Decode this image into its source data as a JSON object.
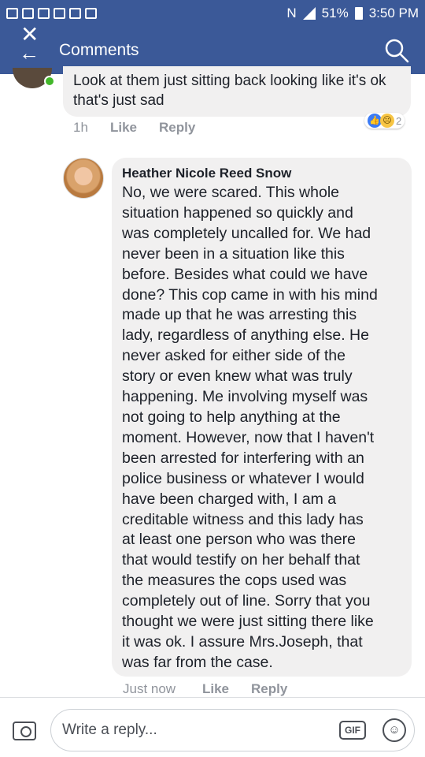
{
  "status_bar": {
    "battery": "51%",
    "time": "3:50 PM"
  },
  "header": {
    "title": "Comments"
  },
  "comments": [
    {
      "text": "Look at them just sitting back looking like it's ok that's just sad",
      "time": "1h",
      "like_label": "Like",
      "reply_label": "Reply",
      "reaction_count": "2"
    },
    {
      "author": "Heather Nicole Reed Snow",
      "lines": [
        "No, we were scared. This whole",
        "situation happened so quickly and",
        "was completely uncalled for. We had",
        "never been in a situation like this",
        "before. Besides what could we have",
        "done? This cop came in with his mind",
        "made up that he was arresting this",
        "lady, regardless of anything else. He",
        "never asked for either side of the",
        "story or even knew what was truly",
        "happening. Me involving myself was",
        "not going to help anything at the",
        "moment. However, now that I haven't",
        "been arrested for interfering with an",
        "police business or whatever I would",
        "have been charged with, I am a",
        "creditable witness and this lady has",
        "at least one person who was there",
        "that would testify on her behalf that",
        "the measures the cops used was",
        "completely out of line. Sorry that you",
        "thought we were just sitting there like",
        "it was ok. I assure Mrs.Joseph, that",
        "was far from the case."
      ],
      "time": "Just now",
      "like_label": "Like",
      "reply_label": "Reply"
    }
  ],
  "composer": {
    "placeholder": "Write a reply...",
    "gif_label": "GIF"
  },
  "colors": {
    "header": "#3b5998",
    "bubble": "#f1f0f0",
    "meta": "#90949c"
  }
}
